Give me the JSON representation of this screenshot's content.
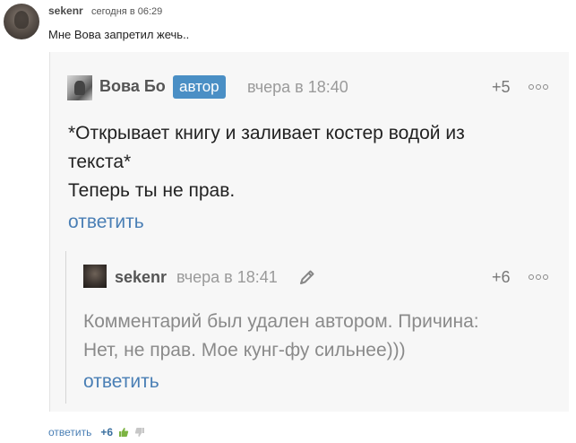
{
  "top_comment": {
    "username": "sekenr",
    "time": "сегодня в 06:29",
    "text": "Мне Вова запретил жечь..",
    "footer": {
      "reply_label": "ответить",
      "score": "+6"
    }
  },
  "reply_comment": {
    "username": "Вова Бо",
    "badge": "автор",
    "time": "вчера в 18:40",
    "score": "+5",
    "lines": [
      "*Открывает книгу и заливает костер водой из",
      "текста*",
      "Теперь ты не прав."
    ],
    "reply_label": "ответить"
  },
  "nested_comment": {
    "username": "sekenr",
    "time": "вчера в 18:41",
    "score": "+6",
    "lines": [
      "Комментарий был удален автором. Причина:",
      "Нет, не прав. Мое кунг-фу сильнее)))"
    ],
    "reply_label": "ответить"
  },
  "colors": {
    "link": "#4a7fb5",
    "badge": "#4a8fc5",
    "thumb_up": "#7cb342",
    "thumb_down": "#c7c7c7"
  }
}
